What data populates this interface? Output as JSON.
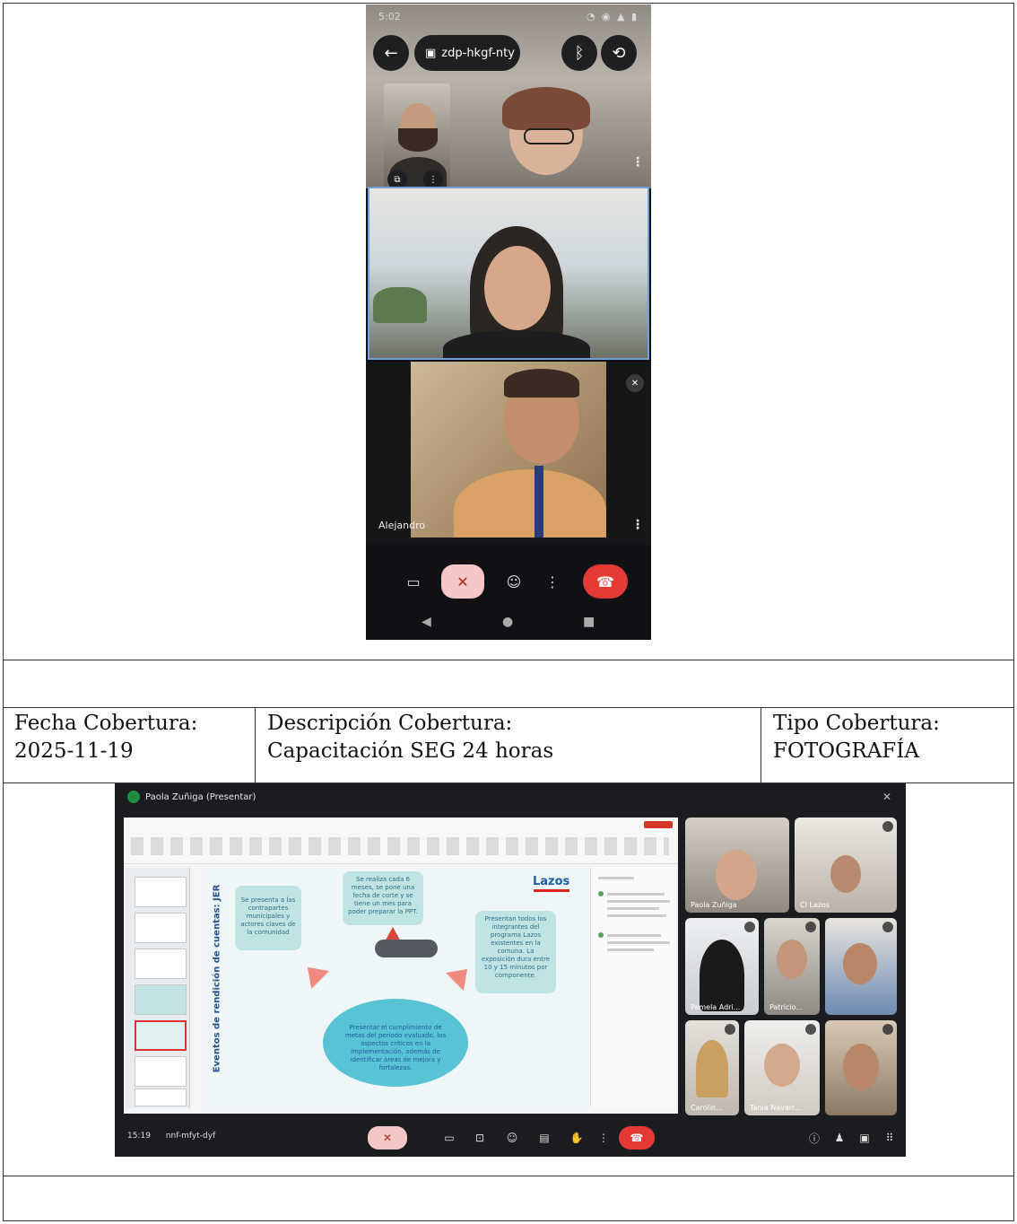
{
  "phone_call": {
    "meeting_code": "zdp-hkgf-nty",
    "participants": [
      {
        "name": ""
      },
      {
        "name": ""
      },
      {
        "name": "Alejandro"
      }
    ],
    "icons": [
      "back-arrow-icon",
      "calendar-icon",
      "bluetooth-icon",
      "switch-camera-icon",
      "camera-icon",
      "mic-off-icon",
      "emoji-icon",
      "more-icon",
      "end-call-icon"
    ],
    "colors": {
      "end_call": "#e53935",
      "mic_off_bg": "#f4c6c6",
      "active_speaker": "#6fa1d8"
    }
  },
  "coverage": {
    "date_label": "Fecha Cobertura:",
    "date_value": "2025-11-19",
    "description_label": "Descripción Cobertura:",
    "description_value": "Capacitación SEG 24 horas",
    "type_label": "Tipo Cobertura:",
    "type_value": "FOTOGRAFÍA"
  },
  "desktop_call": {
    "presenter_title": "Paola Zuñiga (Presentar)",
    "time": "15:19",
    "meeting_code": "nnf-mfyt-dyf",
    "slide": {
      "vertical_title": "Eventos de rendición de cuentas: JER",
      "box_left": "Se presenta a las contrapartes municipales y actores claves de la comunidad",
      "box_top": "Se realiza cada 6 meses, se pone una fecha de corte y se tiene un mes para poder preparar la PPT.",
      "box_right": "Presentan todos los integrantes del programa Lazos existentes en la comuna. La exposición dura entre 10 y 15 minutos por componente.",
      "ellipse": "Presentar el cumplimiento de metas del periodo evaluado, los aspectos críticos en la implementación, además de identificar áreas de mejora y fortalezas.",
      "logo": "Lazos"
    },
    "participants": [
      {
        "name": "Paola Zuñiga"
      },
      {
        "name": "CI Lazos"
      },
      {
        "name": "Pamela Adri..."
      },
      {
        "name": "Patricio..."
      },
      {
        "name": ""
      },
      {
        "name": "Carolin..."
      },
      {
        "name": "Tania Navarr..."
      },
      {
        "name": ""
      }
    ],
    "colors": {
      "end_call": "#e53935",
      "present_bg": "#1b1c1f"
    }
  }
}
